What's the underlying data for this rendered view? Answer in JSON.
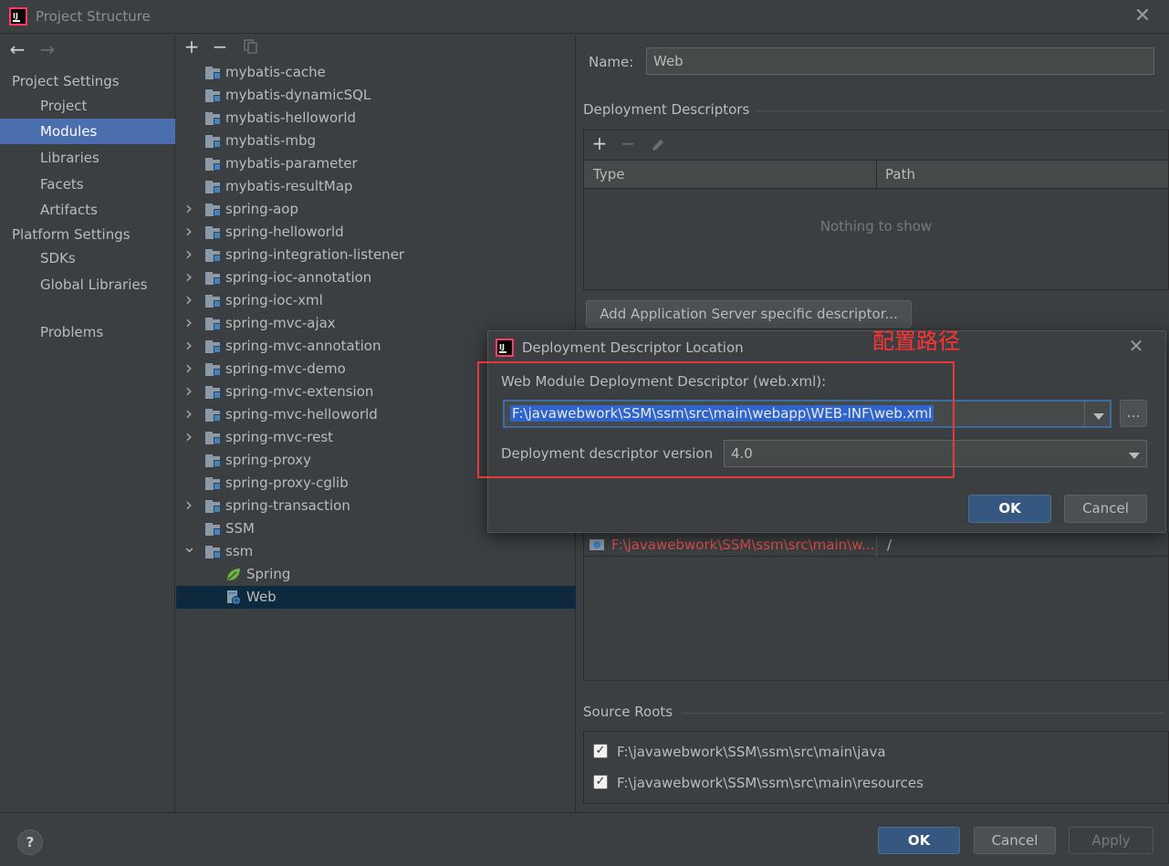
{
  "window": {
    "title": "Project Structure"
  },
  "nav": {
    "back_icon": "arrow-left-icon",
    "forward_icon": "arrow-right-icon",
    "project_settings": "Project Settings",
    "project_items": [
      "Project",
      "Modules",
      "Libraries",
      "Facets",
      "Artifacts"
    ],
    "platform_settings": "Platform Settings",
    "platform_items": [
      "SDKs",
      "Global Libraries"
    ],
    "problems": "Problems",
    "selected": "Modules"
  },
  "tree": {
    "rows": [
      {
        "label": "mybatis-cache",
        "chevron": ""
      },
      {
        "label": "mybatis-dynamicSQL",
        "chevron": ""
      },
      {
        "label": "mybatis-helloworld",
        "chevron": ""
      },
      {
        "label": "mybatis-mbg",
        "chevron": ""
      },
      {
        "label": "mybatis-parameter",
        "chevron": ""
      },
      {
        "label": "mybatis-resultMap",
        "chevron": ""
      },
      {
        "label": "spring-aop",
        "chevron": ">"
      },
      {
        "label": "spring-helloworld",
        "chevron": ">"
      },
      {
        "label": "spring-integration-listener",
        "chevron": ">"
      },
      {
        "label": "spring-ioc-annotation",
        "chevron": ">"
      },
      {
        "label": "spring-ioc-xml",
        "chevron": ">"
      },
      {
        "label": "spring-mvc-ajax",
        "chevron": ">"
      },
      {
        "label": "spring-mvc-annotation",
        "chevron": ">"
      },
      {
        "label": "spring-mvc-demo",
        "chevron": ">"
      },
      {
        "label": "spring-mvc-extension",
        "chevron": ">"
      },
      {
        "label": "spring-mvc-helloworld",
        "chevron": ">"
      },
      {
        "label": "spring-mvc-rest",
        "chevron": ">"
      },
      {
        "label": "spring-proxy",
        "chevron": ""
      },
      {
        "label": "spring-proxy-cglib",
        "chevron": ""
      },
      {
        "label": "spring-transaction",
        "chevron": ">"
      },
      {
        "label": "SSM",
        "chevron": ""
      },
      {
        "label": "ssm",
        "chevron": "v"
      }
    ],
    "facets": [
      {
        "label": "Spring",
        "icon": "spring-leaf-icon"
      },
      {
        "label": "Web",
        "icon": "web-facet-icon"
      }
    ],
    "selected": "Web"
  },
  "details": {
    "name_label": "Name:",
    "name_value": "Web",
    "deployment_descriptors": "Deployment Descriptors",
    "col_type": "Type",
    "col_path": "Path",
    "empty_text": "Nothing to show",
    "add_server_button": "Add Application Server specific descriptor...",
    "web_resource_path": "F:\\javawebwork\\SSM\\ssm\\src\\main\\w...",
    "web_resource_relative": "/",
    "source_roots": "Source Roots",
    "source_paths": [
      "F:\\javawebwork\\SSM\\ssm\\src\\main\\java",
      "F:\\javawebwork\\SSM\\ssm\\src\\main\\resources"
    ]
  },
  "dialog": {
    "title": "Deployment Descriptor Location",
    "descriptor_label": "Web Module Deployment Descriptor (web.xml):",
    "descriptor_value": "F:\\javawebwork\\SSM\\ssm\\src\\main\\webapp\\WEB-INF\\web.xml",
    "browse_label": "...",
    "version_label": "Deployment descriptor version",
    "version_value": "4.0",
    "ok": "OK",
    "cancel": "Cancel"
  },
  "annotation": {
    "note": "配置路径",
    "color": "#ff3333"
  },
  "footer": {
    "help": "?",
    "ok": "OK",
    "cancel": "Cancel",
    "apply": "Apply"
  }
}
